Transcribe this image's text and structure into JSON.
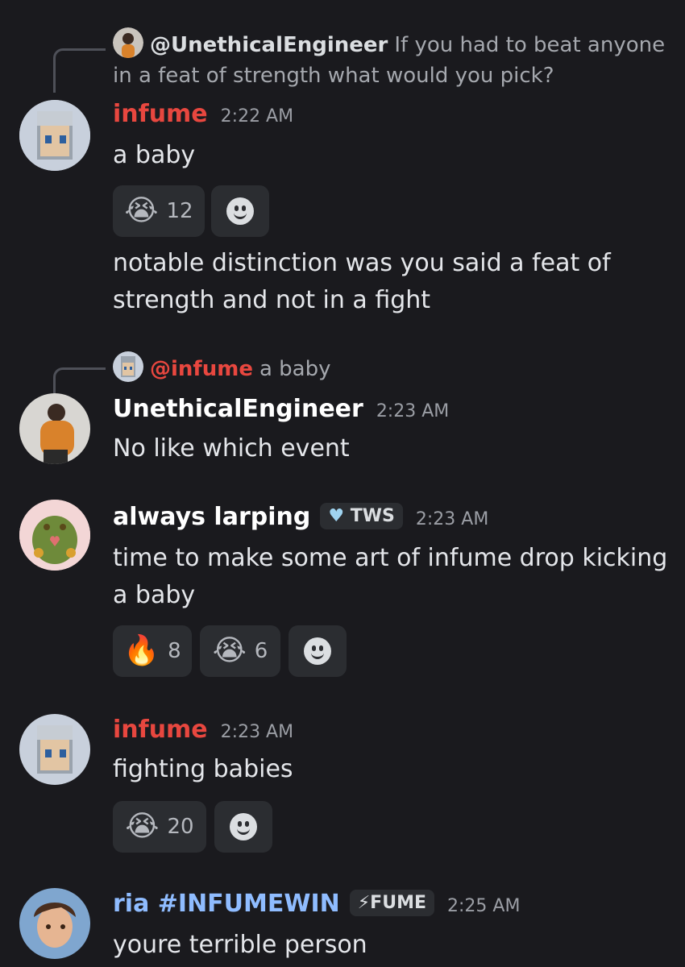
{
  "messages": [
    {
      "reply": {
        "name": "@UnethicalEngineer",
        "text_line1": "If you had to beat anyone",
        "text_line2": "in a feat of strength what would you pick?"
      },
      "author": "infume",
      "time": "2:22 AM",
      "lines": [
        "a baby"
      ],
      "reactions": [
        {
          "emoji": "😭",
          "count": "12"
        }
      ],
      "followup": [
        "notable distinction was you said a feat of",
        "strength and not in a fight"
      ]
    },
    {
      "reply": {
        "name": "@infume",
        "text": "a baby"
      },
      "author": "UnethicalEngineer",
      "time": "2:23 AM",
      "lines": [
        "No like which event"
      ]
    },
    {
      "author": "always larping",
      "tag": "TWS",
      "time": "2:23 AM",
      "lines": [
        "time to make some art of infume drop kicking",
        "a baby"
      ],
      "reactions": [
        {
          "emoji": "🔥",
          "count": "8"
        },
        {
          "emoji": "😭",
          "count": "6"
        }
      ]
    },
    {
      "author": "infume",
      "time": "2:23 AM",
      "lines": [
        "fighting babies"
      ],
      "reactions": [
        {
          "emoji": "😭",
          "count": "20"
        }
      ]
    },
    {
      "author": "ria #INFUMEWIN",
      "tag": "⚡FUME",
      "time": "2:25 AM",
      "lines": [
        "youre terrible person"
      ]
    }
  ],
  "icons": {
    "add_reaction": "add-reaction-smiley-icon",
    "shield": "tws-badge-icon"
  },
  "colors": {
    "background": "#1a1a1e",
    "infume_name": "#e8473f",
    "ria_name": "#8fbcff",
    "chip": "#2b2d31"
  }
}
